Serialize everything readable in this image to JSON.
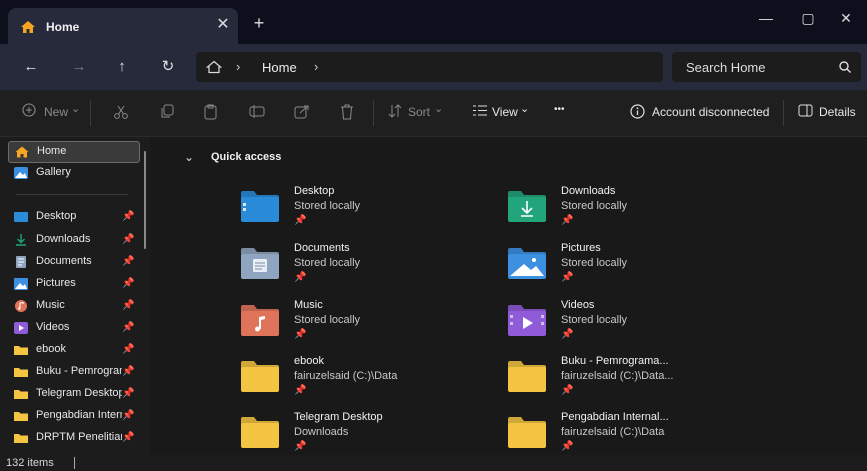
{
  "tab": {
    "title": "Home",
    "close": "✕",
    "new_tab": "+"
  },
  "window_controls": {
    "minimize": "—",
    "maximize": "▢",
    "close": "✕"
  },
  "nav": {
    "back": "←",
    "forward": "→",
    "up": "↑",
    "refresh": "↻"
  },
  "address": {
    "sep": "›",
    "crumb": "Home"
  },
  "search": {
    "placeholder": "Search Home"
  },
  "toolbar": {
    "new": "New",
    "sort": "Sort",
    "view": "View",
    "more": "•••",
    "account": "Account disconnected",
    "details": "Details",
    "dropdown": "⌄"
  },
  "sidebar": {
    "top": [
      {
        "label": "Home",
        "icon": "home-icon",
        "color": "#f5a623"
      },
      {
        "label": "Gallery",
        "icon": "gallery-icon",
        "color": "#3b8ee0"
      }
    ],
    "items": [
      {
        "label": "Desktop",
        "icon": "desktop-folder-icon",
        "color": "#2a8bd8"
      },
      {
        "label": "Downloads",
        "icon": "download-icon",
        "color": "#23a57c"
      },
      {
        "label": "Documents",
        "icon": "documents-icon",
        "color": "#8fa4bf"
      },
      {
        "label": "Pictures",
        "icon": "pictures-icon",
        "color": "#3d8fe0"
      },
      {
        "label": "Music",
        "icon": "music-icon",
        "color": "#e0745a"
      },
      {
        "label": "Videos",
        "icon": "videos-icon",
        "color": "#8f5bd9"
      },
      {
        "label": "ebook",
        "icon": "folder-icon",
        "color": "#f4c542"
      },
      {
        "label": "Buku - Pemrograman",
        "icon": "folder-icon",
        "color": "#f4c542"
      },
      {
        "label": "Telegram Desktop",
        "icon": "folder-icon",
        "color": "#f4c542"
      },
      {
        "label": "Pengabdian Internal",
        "icon": "folder-icon",
        "color": "#f4c542"
      },
      {
        "label": "DRPTM Penelitian",
        "icon": "folder-icon",
        "color": "#f4c542"
      }
    ],
    "pin": "📌"
  },
  "quick_access": {
    "title": "Quick access",
    "chevron": "⌄",
    "items": [
      {
        "name": "Desktop",
        "sub": "Stored locally",
        "icon": "desktop-folder-icon",
        "color": "#2a8bd8"
      },
      {
        "name": "Downloads",
        "sub": "Stored locally",
        "icon": "downloads-folder-icon",
        "color": "#23a57c"
      },
      {
        "name": "Documents",
        "sub": "Stored locally",
        "icon": "documents-folder-icon",
        "color": "#8fa4bf"
      },
      {
        "name": "Pictures",
        "sub": "Stored locally",
        "icon": "pictures-folder-icon",
        "color": "#3d8fe0"
      },
      {
        "name": "Music",
        "sub": "Stored locally",
        "icon": "music-folder-icon",
        "color": "#e0745a"
      },
      {
        "name": "Videos",
        "sub": "Stored locally",
        "icon": "videos-folder-icon",
        "color": "#8f5bd9"
      },
      {
        "name": "ebook",
        "sub": "fairuzelsaid (C:)\\Data",
        "icon": "folder-icon",
        "color": "#f4c542"
      },
      {
        "name": "Buku - Pemrograma...",
        "sub": "fairuzelsaid (C:)\\Data...",
        "icon": "folder-icon",
        "color": "#f4c542"
      },
      {
        "name": "Telegram Desktop",
        "sub": "Downloads",
        "icon": "folder-icon",
        "color": "#f4c542"
      },
      {
        "name": "Pengabdian Internal...",
        "sub": "fairuzelsaid (C:)\\Data",
        "icon": "folder-icon",
        "color": "#f4c542"
      }
    ]
  },
  "status": {
    "count": "132 items"
  }
}
